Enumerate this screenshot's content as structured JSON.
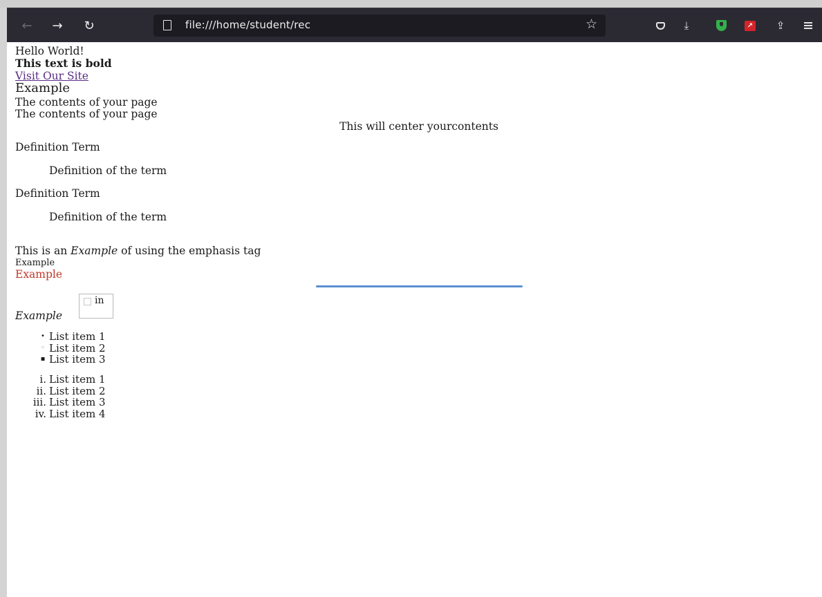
{
  "browser": {
    "url": "file:///home/student/rec",
    "back_icon": "back-arrow-icon",
    "forward_icon": "forward-arrow-icon",
    "reload_icon": "reload-icon",
    "toolbar_icons": [
      "pocket-icon",
      "download-icon",
      "shield-extension-icon",
      "red-extension-icon",
      "share-icon",
      "menu-icon"
    ]
  },
  "page": {
    "hello": "Hello World!",
    "bold_text": "This text is bold",
    "link_text": "Visit Our Site",
    "example_heading": "Example",
    "contents_1": "The contents of your page",
    "contents_2": "The contents of your page",
    "centered": "This will center yourcontents",
    "definitions": [
      {
        "term": "Definition Term",
        "desc": "Definition of the term"
      },
      {
        "term": "Definition Term",
        "desc": "Definition of the term"
      }
    ],
    "emphasis_before": "This is an ",
    "emphasis_word": "Example",
    "emphasis_after": " of using the emphasis tag",
    "small_example": "Example",
    "red_example": "Example",
    "red_color": "#c0392b",
    "hr_color": "#5b8fd1",
    "italic_example": "Example",
    "image_alt": "in",
    "unordered_list": [
      {
        "marker": "•",
        "text": "List item 1"
      },
      {
        "marker": "◦",
        "text": "List item 2"
      },
      {
        "marker": "▪",
        "text": "List item 3"
      }
    ],
    "ordered_list": [
      {
        "marker": "i.",
        "text": "List item 1"
      },
      {
        "marker": "ii.",
        "text": "List item 2"
      },
      {
        "marker": "iii.",
        "text": "List item 3"
      },
      {
        "marker": "iv.",
        "text": "List item 4"
      }
    ]
  }
}
